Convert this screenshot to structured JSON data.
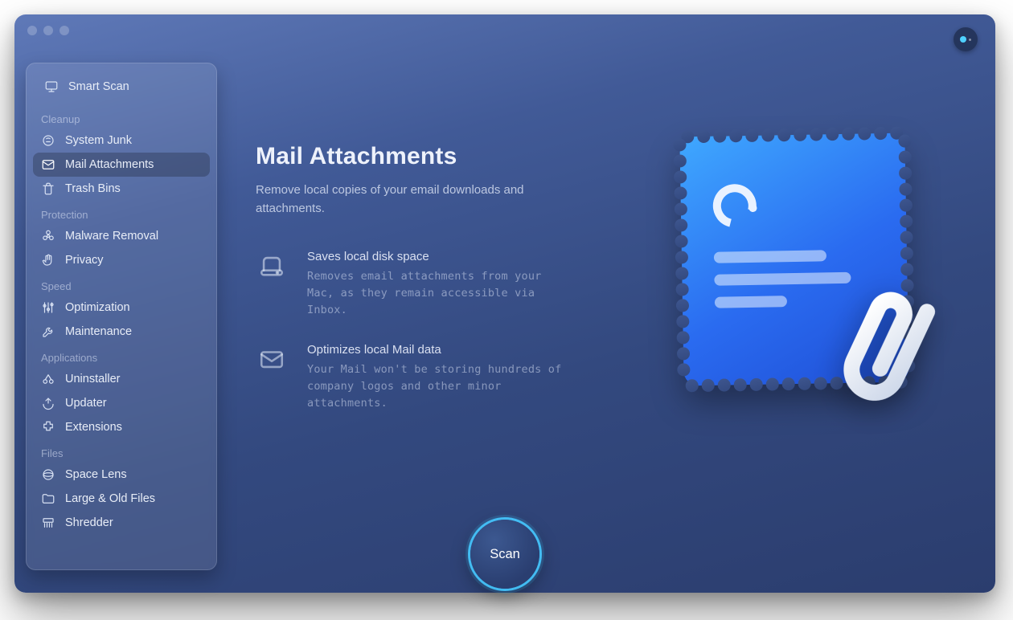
{
  "sidebar": {
    "smart_scan": "Smart Scan",
    "groups": [
      {
        "label": "Cleanup",
        "items": [
          {
            "id": "system-junk",
            "label": "System Junk"
          },
          {
            "id": "mail-attachments",
            "label": "Mail Attachments",
            "active": true
          },
          {
            "id": "trash-bins",
            "label": "Trash Bins"
          }
        ]
      },
      {
        "label": "Protection",
        "items": [
          {
            "id": "malware-removal",
            "label": "Malware Removal"
          },
          {
            "id": "privacy",
            "label": "Privacy"
          }
        ]
      },
      {
        "label": "Speed",
        "items": [
          {
            "id": "optimization",
            "label": "Optimization"
          },
          {
            "id": "maintenance",
            "label": "Maintenance"
          }
        ]
      },
      {
        "label": "Applications",
        "items": [
          {
            "id": "uninstaller",
            "label": "Uninstaller"
          },
          {
            "id": "updater",
            "label": "Updater"
          },
          {
            "id": "extensions",
            "label": "Extensions"
          }
        ]
      },
      {
        "label": "Files",
        "items": [
          {
            "id": "space-lens",
            "label": "Space Lens"
          },
          {
            "id": "large-old-files",
            "label": "Large & Old Files"
          },
          {
            "id": "shredder",
            "label": "Shredder"
          }
        ]
      }
    ]
  },
  "main": {
    "title": "Mail Attachments",
    "lead": "Remove local copies of your email downloads and attachments.",
    "features": [
      {
        "title": "Saves local disk space",
        "desc": "Removes email attachments from your Mac, as they remain accessible via Inbox."
      },
      {
        "title": "Optimizes local Mail data",
        "desc": "Your Mail won't be storing hundreds of company logos and other minor attachments."
      }
    ]
  },
  "scan_label": "Scan"
}
